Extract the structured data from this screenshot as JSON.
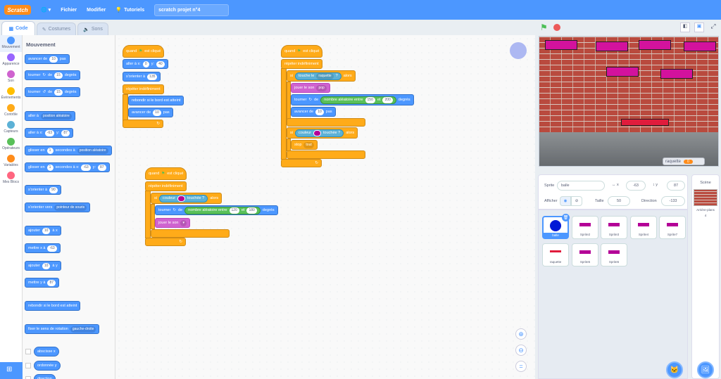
{
  "menubar": {
    "logo": "Scratch",
    "file": "Fichier",
    "edit": "Modifier",
    "tutorials": "Tutoriels",
    "project_title": "scratch projet n°4"
  },
  "tabs": {
    "code": "Code",
    "costumes": "Costumes",
    "sounds": "Sons"
  },
  "categories": [
    "Mouvement",
    "Apparence",
    "Son",
    "Événements",
    "Contrôle",
    "Capteurs",
    "Opérateurs",
    "Variables",
    "Mes Blocs"
  ],
  "category_colors": [
    "#4c97ff",
    "#9966ff",
    "#cf63cf",
    "#ffbf00",
    "#ffab19",
    "#5cb1d6",
    "#59c059",
    "#ff8c1a",
    "#ff6680"
  ],
  "palette": {
    "title": "Mouvement",
    "avancer": "avancer de",
    "avancer_val": "10",
    "pas": "pas",
    "tourner": "tourner",
    "de": "de",
    "deg": "degrés",
    "turn_val": "15",
    "aller_a": "aller à",
    "pos_aleatoire": "position aléatoire",
    "aller_xy": "aller à x:",
    "x_val": "-63",
    "y_lab": "y:",
    "y_val": "87",
    "glisser": "glisser en",
    "glisser_val": "1",
    "sec_a": "secondes à",
    "sec_ax": "secondes à x:",
    "orienter": "s'orienter à",
    "orient_val": "90",
    "orienter_vers": "s'orienter vers",
    "pointeur": "pointeur de souris",
    "ajouter_x": "ajouter",
    "add_val": "10",
    "a_x": "à x",
    "mettre_x": "mettre x à",
    "a_y": "à y",
    "mettre_y": "mettre y à",
    "rebondir": "rebondir si le bord est atteint",
    "fixer": "fixer le sens de rotation",
    "gauche_droite": "gauche-droite",
    "abscisse": "abscisse x",
    "ordonnee": "ordonnée y",
    "direction": "direction"
  },
  "script1": {
    "hat": "quand",
    "hat2": "est cliqué",
    "aller_a": "aller à x:",
    "x": "0",
    "y_lab": "y:",
    "y": "40",
    "orienter": "s'orienter à",
    "orient": "135",
    "repeter": "répéter indéfiniment",
    "rebondir": "rebondir si le bord est atteint",
    "avancer": "avancer de",
    "av": "10",
    "pas": "pas"
  },
  "script2": {
    "hat": "quand",
    "hat2": "est cliqué",
    "repeter": "répéter indéfiniment",
    "si": "si",
    "couleur": "couleur",
    "touchee": "touchée ?",
    "alors": "alors",
    "tourner": "tourner",
    "de": "de",
    "aleatoire": "nombre aléatoire entre",
    "min": "120",
    "et": "et",
    "max": "180",
    "degres": "degrés",
    "jouer": "jouer le son"
  },
  "script3": {
    "hat": "quand",
    "hat2": "est cliqué",
    "repeter": "répéter indéfiniment",
    "si": "si",
    "touche": "touche le",
    "raquette": "raquette",
    "q": "?",
    "alors": "alors",
    "jouer": "jouer le son",
    "pop": "pop",
    "tourner": "tourner",
    "de": "de",
    "aleatoire": "nombre aléatoire entre",
    "min": "150",
    "et": "et",
    "max": "200",
    "degres": "degrés",
    "avancer": "avancer de",
    "av": "10",
    "pas": "pas",
    "couleur": "couleur",
    "touchee": "touchée ?",
    "stop": "stop",
    "tout": "tout"
  },
  "stage_monitor": {
    "label": "raquette",
    "value": "0"
  },
  "sprite_info": {
    "sprite_label": "Sprite",
    "sprite_name": "balle",
    "x": "-63",
    "y": "87",
    "afficher": "Afficher",
    "taille": "Taille",
    "taille_val": "50",
    "direction": "Direction",
    "direction_val": "-133"
  },
  "sprites": [
    "balle",
    "Sprite2",
    "Sprite3",
    "Sprite4",
    "Sprite7",
    "raquette",
    "Sprite5",
    "Sprite6"
  ],
  "stage_panel": {
    "title": "Scène",
    "backdrops": "Arrière-plans",
    "count": "4"
  }
}
